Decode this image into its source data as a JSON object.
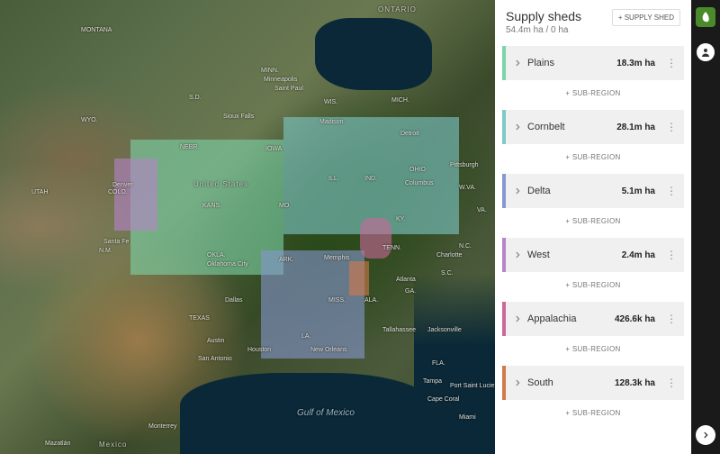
{
  "panel": {
    "title": "Supply sheds",
    "subtitle": "54.4m ha / 0 ha",
    "add_button": "+ SUPPLY SHED",
    "sub_region_button": "+ SUB-REGION"
  },
  "sheds": [
    {
      "name": "Plains",
      "value": "18.3m ha",
      "accent": "#7dd4a8"
    },
    {
      "name": "Cornbelt",
      "value": "28.1m ha",
      "accent": "#7fc9c9"
    },
    {
      "name": "Delta",
      "value": "5.1m ha",
      "accent": "#8798d0"
    },
    {
      "name": "West",
      "value": "2.4m ha",
      "accent": "#b584c9"
    },
    {
      "name": "Appalachia",
      "value": "426.6k ha",
      "accent": "#c9699a"
    },
    {
      "name": "South",
      "value": "128.3k ha",
      "accent": "#d47a4a"
    }
  ],
  "map_labels": {
    "ontario": "ONTARIO",
    "us": "United States",
    "mexico_country": "Mexico",
    "gulf": "Gulf of Mexico",
    "montana": "MONTANA",
    "wyo": "WYO.",
    "utah": "UTAH",
    "colo": "COLO.",
    "nm": "N.M.",
    "texas": "TEXAS",
    "okla": "OKLA.",
    "ark": "ARK.",
    "sd": "S.D.",
    "nebr": "NEBR.",
    "kans": "KANS.",
    "minn": "MINN.",
    "iowa": "IOWA",
    "mo": "MO.",
    "wis": "WIS.",
    "ill": "ILL.",
    "ind": "IND.",
    "mich": "MICH.",
    "ohio": "OHIO",
    "ky": "KY.",
    "tenn": "TENN.",
    "miss": "MISS.",
    "ala": "ALA.",
    "ga": "GA.",
    "fla": "FLA.",
    "sc": "S.C.",
    "nc": "N.C.",
    "va": "VA.",
    "wva": "W.VA.",
    "la": "LA.",
    "saint_paul": "Saint Paul",
    "madison": "Madison",
    "sioux_falls": "Sioux Falls",
    "minneapolis": "Minneapolis",
    "detroit": "Detroit",
    "pittsburgh": "Pittsburgh",
    "columbus": "Columbus",
    "denver": "Denver",
    "santa_fe": "Santa Fe",
    "okc": "Oklahoma City",
    "dallas": "Dallas",
    "austin": "Austin",
    "san_antonio": "San Antonio",
    "houston": "Houston",
    "memphis": "Memphis",
    "atlanta": "Atlanta",
    "jacksonville": "Jacksonville",
    "tallahassee": "Tallahassee",
    "charlotte": "Charlotte",
    "tampa": "Tampa",
    "miami": "Miami",
    "cape_coral": "Cape Coral",
    "port_lucie": "Port Saint Lucie",
    "new_orleans": "New Orleans",
    "monterrey": "Monterrey",
    "mazatlan": "Mazatlán"
  }
}
